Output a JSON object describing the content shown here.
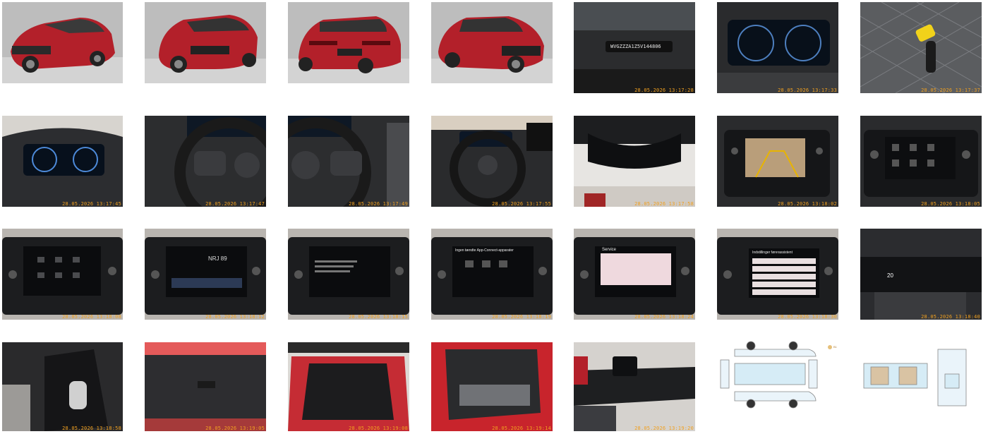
{
  "tiles": [
    {
      "kind": "car-front-left",
      "stamp": ""
    },
    {
      "kind": "car-rear-left",
      "stamp": ""
    },
    {
      "kind": "car-rear",
      "stamp": ""
    },
    {
      "kind": "car-front-right",
      "stamp": ""
    },
    {
      "kind": "windshield-vin",
      "stamp": "28.05.2026 13:17:28",
      "vin": "WVGZZZA1Z5V144806"
    },
    {
      "kind": "digital-cluster",
      "stamp": "28.05.2026 13:17:33"
    },
    {
      "kind": "seat-key",
      "stamp": "28.05.2026 13:17:37"
    },
    {
      "kind": "cluster-wide",
      "stamp": "28.05.2026 13:17:45"
    },
    {
      "kind": "steering-left",
      "stamp": "28.05.2026 13:17:47"
    },
    {
      "kind": "steering-right",
      "stamp": "28.05.2026 13:17:49"
    },
    {
      "kind": "steering-full",
      "stamp": "28.05.2026 13:17:55"
    },
    {
      "kind": "mirror",
      "stamp": "28.05.2026 13:17:58"
    },
    {
      "kind": "camera-screen",
      "stamp": "28.05.2026 13:18:02"
    },
    {
      "kind": "infotainment-menu",
      "stamp": "28.05.2026 13:18:05"
    },
    {
      "kind": "infotainment-home",
      "stamp": "28.05.2026 13:18:08"
    },
    {
      "kind": "infotainment-radio",
      "stamp": "28.05.2026 13:18:12",
      "screen_text": "NRJ 89"
    },
    {
      "kind": "infotainment-phone",
      "stamp": "28.05.2026 13:18:15"
    },
    {
      "kind": "infotainment-app",
      "stamp": "28.05.2026 13:18:19",
      "screen_text": "Ingen tændte App-Connect-apparater"
    },
    {
      "kind": "infotainment-service",
      "stamp": "28.05.2026 13:18:24",
      "screen_text": "Service"
    },
    {
      "kind": "infotainment-settings",
      "stamp": "28.05.2026 13:18:30",
      "screen_text": "Indstillinger førerassistent"
    },
    {
      "kind": "climate",
      "stamp": "28.05.2026 13:18:40",
      "screen_text": "20"
    },
    {
      "kind": "gear-lever",
      "stamp": "28.05.2026 13:18:58"
    },
    {
      "kind": "trunk-lid",
      "stamp": "28.05.2026 13:19:05"
    },
    {
      "kind": "trunk-open",
      "stamp": "28.05.2026 13:19:08"
    },
    {
      "kind": "rear-seat",
      "stamp": "28.05.2026 13:19:14"
    },
    {
      "kind": "dashboard",
      "stamp": "28.05.2026 13:19:20"
    },
    {
      "kind": "damage-diagram-exterior",
      "stamp": ""
    },
    {
      "kind": "damage-diagram-interior",
      "stamp": ""
    }
  ],
  "legend_label": "B1",
  "colors": {
    "car_red": "#b3202a",
    "stamp": "#f0a020",
    "bg_gray": "#c8c8c8",
    "dash_dark": "#1b1c1f",
    "diagram_blue": "#d6ecf6",
    "diagram_beige": "#d9c3a3"
  }
}
